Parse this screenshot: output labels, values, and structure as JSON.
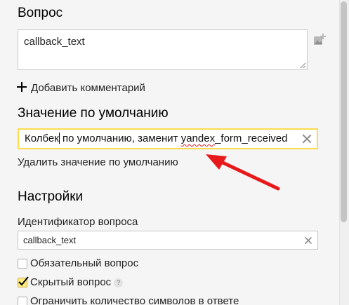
{
  "question": {
    "title": "Вопрос",
    "textarea_value": "callback_text",
    "add_comment_label": "Добавить комментарий"
  },
  "default_value": {
    "title": "Значение по умолчанию",
    "input_before_caret": "Колбек",
    "input_middle": " по умолчанию, заменит ",
    "input_misspelled": "yandex",
    "input_after": "_form_received",
    "remove_label": "Удалить значение по умолчанию"
  },
  "settings": {
    "title": "Настройки",
    "id_label": "Идентификатор вопроса",
    "id_value": "callback_text",
    "checkboxes": [
      {
        "label": "Обязательный вопрос",
        "checked": false
      },
      {
        "label": "Скрытый вопрос",
        "checked": true
      },
      {
        "label": "Ограничить количество символов в ответе",
        "checked": false
      }
    ],
    "help_glyph": "?"
  },
  "colors": {
    "focus_border": "#ffdb4d",
    "arrow": "#e8191b",
    "checkbox_checked": "#ffeb80"
  },
  "icons": [
    "add-image-icon",
    "plus-icon",
    "clear-icon",
    "checkmark-icon",
    "help-icon",
    "red-arrow"
  ]
}
